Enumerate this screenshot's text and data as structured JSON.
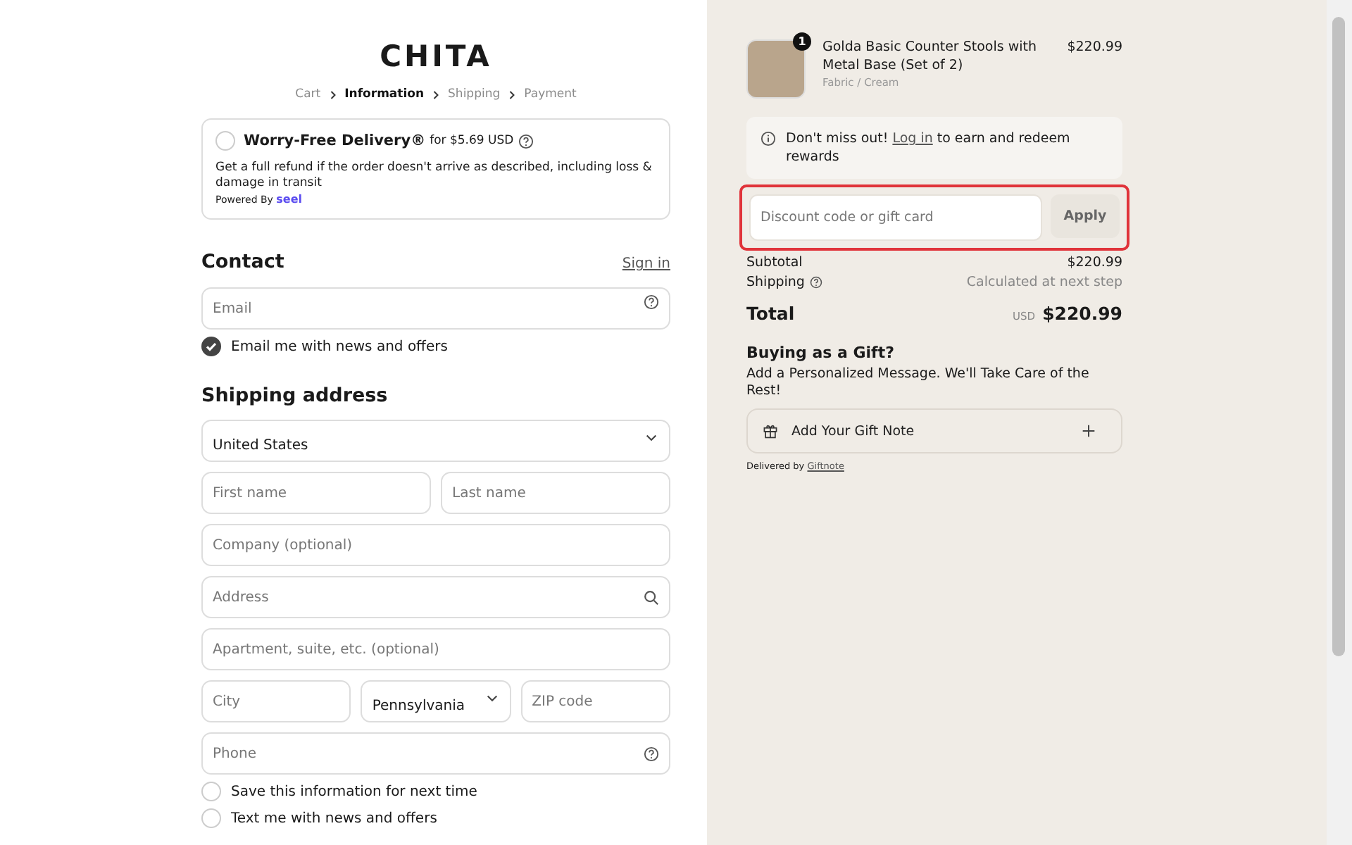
{
  "logo": "CHITA",
  "breadcrumb": [
    {
      "label": "Cart",
      "selected": false
    },
    {
      "label": "Information",
      "selected": true
    },
    {
      "label": "Shipping",
      "selected": false
    },
    {
      "label": "Payment",
      "selected": false
    }
  ],
  "protection": {
    "title": "Worry-Free Delivery®",
    "price": "for $5.69 USD",
    "checked": false,
    "description": "Get a full refund if the order doesn't arrive as described, including loss & damage in transit",
    "powered_by": "Powered By",
    "brand": "seel"
  },
  "contact": {
    "heading": "Contact",
    "sign_in": "Sign in",
    "email": {
      "placeholder": "Email"
    },
    "newsletter": {
      "label": "Email me with news and offers",
      "checked": true
    }
  },
  "shipping": {
    "heading": "Shipping address",
    "rows": [
      [
        {
          "kind": "select",
          "value": "United States"
        }
      ],
      [
        {
          "kind": "input",
          "placeholder": "First name"
        },
        {
          "kind": "input",
          "placeholder": "Last name"
        }
      ],
      [
        {
          "kind": "input",
          "placeholder": "Company (optional)"
        }
      ],
      [
        {
          "kind": "search",
          "placeholder": "Address"
        }
      ],
      [
        {
          "kind": "input",
          "placeholder": "Apartment, suite, etc. (optional)"
        }
      ],
      [
        {
          "kind": "input",
          "placeholder": "City"
        },
        {
          "kind": "select",
          "value": "Pennsylvania"
        },
        {
          "kind": "input",
          "placeholder": "ZIP code"
        }
      ],
      [
        {
          "kind": "help",
          "placeholder": "Phone"
        }
      ]
    ],
    "options": [
      {
        "label": "Save this information for next time",
        "checked": false
      },
      {
        "label": "Text me with news and offers",
        "checked": false
      }
    ]
  },
  "summary": {
    "item": {
      "quantity": "1",
      "name": "Golda Basic Counter Stools with Metal Base (Set of 2)",
      "variant": "Fabric / Cream",
      "price": "$220.99"
    },
    "notice": {
      "before": "Don't miss out!",
      "link": "Log in",
      "after": "to earn and redeem rewards"
    },
    "discount": {
      "placeholder": "Discount code or gift card",
      "button": "Apply",
      "highlighted": true
    },
    "subtotal": {
      "label": "Subtotal",
      "value": "$220.99"
    },
    "shipping": {
      "label": "Shipping",
      "value": "Calculated at next step"
    },
    "total": {
      "label": "Total",
      "currency": "USD",
      "value": "$220.99"
    },
    "gift": {
      "heading": "Buying as a Gift?",
      "text": "Add a Personalized Message. We'll Take Care of the Rest!",
      "button": "Add Your Gift Note",
      "delivered_by": "Delivered by",
      "provider": "Giftnote"
    }
  }
}
